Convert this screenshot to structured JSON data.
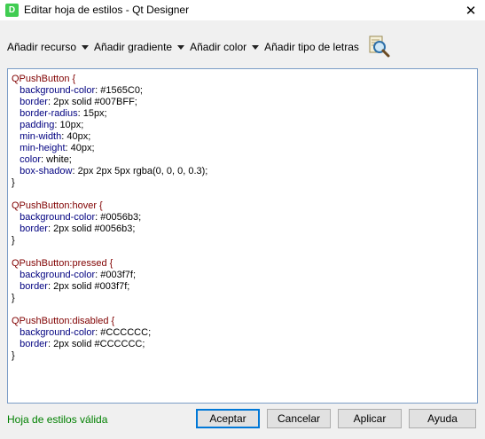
{
  "window": {
    "title": "Editar hoja de estilos - Qt Designer",
    "app_icon_letter": "D",
    "close_glyph": "✕"
  },
  "toolbar": {
    "items": [
      {
        "label": "Añadir recurso"
      },
      {
        "label": "Añadir gradiente"
      },
      {
        "label": "Añadir color"
      },
      {
        "label": "Añadir tipo de letras"
      }
    ],
    "find_icon": "magnifier-document-icon"
  },
  "editor": {
    "lines": [
      [
        {
          "t": "QPushButton {",
          "c": "sel"
        }
      ],
      [
        {
          "t": "   background-color",
          "c": "prop"
        },
        {
          "t": ": #1565C0;",
          "c": "plain"
        }
      ],
      [
        {
          "t": "   border",
          "c": "prop"
        },
        {
          "t": ": 2px solid #007BFF;",
          "c": "plain"
        }
      ],
      [
        {
          "t": "   border-radius",
          "c": "prop"
        },
        {
          "t": ": 15px;",
          "c": "plain"
        }
      ],
      [
        {
          "t": "   padding",
          "c": "prop"
        },
        {
          "t": ": 10px;",
          "c": "plain"
        }
      ],
      [
        {
          "t": "   min-width",
          "c": "prop"
        },
        {
          "t": ": 40px;",
          "c": "plain"
        }
      ],
      [
        {
          "t": "   min-height",
          "c": "prop"
        },
        {
          "t": ": 40px;",
          "c": "plain"
        }
      ],
      [
        {
          "t": "   color",
          "c": "prop"
        },
        {
          "t": ": white;",
          "c": "plain"
        }
      ],
      [
        {
          "t": "   box-shadow",
          "c": "prop"
        },
        {
          "t": ": 2px 2px 5px rgba(0, 0, 0, 0.3);",
          "c": "plain"
        }
      ],
      [
        {
          "t": "}",
          "c": "plain"
        }
      ],
      [
        {
          "t": "",
          "c": "plain"
        }
      ],
      [
        {
          "t": "QPushButton:hover {",
          "c": "sel"
        }
      ],
      [
        {
          "t": "   background-color",
          "c": "prop"
        },
        {
          "t": ": #0056b3;",
          "c": "plain"
        }
      ],
      [
        {
          "t": "   border",
          "c": "prop"
        },
        {
          "t": ": 2px solid #0056b3;",
          "c": "plain"
        }
      ],
      [
        {
          "t": "}",
          "c": "plain"
        }
      ],
      [
        {
          "t": "",
          "c": "plain"
        }
      ],
      [
        {
          "t": "QPushButton:pressed {",
          "c": "sel"
        }
      ],
      [
        {
          "t": "   background-color",
          "c": "prop"
        },
        {
          "t": ": #003f7f;",
          "c": "plain"
        }
      ],
      [
        {
          "t": "   border",
          "c": "prop"
        },
        {
          "t": ": 2px solid #003f7f;",
          "c": "plain"
        }
      ],
      [
        {
          "t": "}",
          "c": "plain"
        }
      ],
      [
        {
          "t": "",
          "c": "plain"
        }
      ],
      [
        {
          "t": "QPushButton:disabled {",
          "c": "sel"
        }
      ],
      [
        {
          "t": "   background-color",
          "c": "prop"
        },
        {
          "t": ": #CCCCCC;",
          "c": "plain"
        }
      ],
      [
        {
          "t": "   border",
          "c": "prop"
        },
        {
          "t": ": 2px solid #CCCCCC;",
          "c": "plain"
        }
      ],
      [
        {
          "t": "}",
          "c": "plain"
        }
      ]
    ]
  },
  "status": {
    "text": "Hoja de estilos válida",
    "color": "#008000"
  },
  "buttons": {
    "accept": "Aceptar",
    "cancel": "Cancelar",
    "apply": "Aplicar",
    "help": "Ayuda"
  },
  "colors": {
    "selector": "#800000",
    "property": "#000080",
    "default_button_border": "#0078d7",
    "qt_green": "#41cd52"
  }
}
